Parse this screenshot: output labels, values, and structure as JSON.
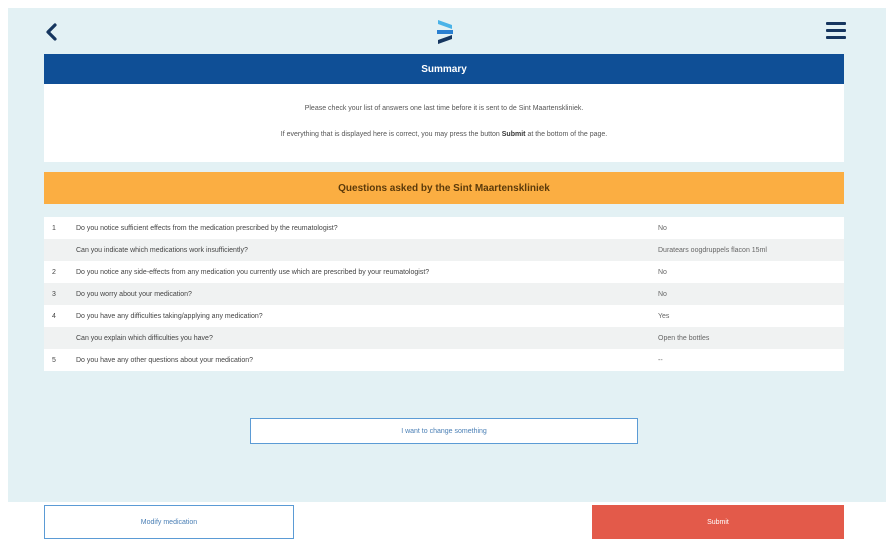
{
  "colors": {
    "page_bg": "#e3f1f4",
    "summary_header": "#0f4f96",
    "questions_header": "#fbae42",
    "submit": "#e35a4a",
    "outline": "#5b9bd5"
  },
  "topbar": {
    "back_icon": "chevron-left-icon",
    "logo_icon": "app-logo",
    "menu_icon": "hamburger-menu-icon"
  },
  "summary": {
    "title": "Summary",
    "line1": "Please check your list of answers one last time before it is sent to de Sint Maartenskliniek.",
    "line2_pre": "If everything that is displayed here is correct, you may press the button ",
    "line2_bold": "Submit",
    "line2_post": " at the bottom of the page."
  },
  "questions": {
    "title": "Questions asked by the Sint Maartenskliniek",
    "rows": [
      {
        "num": "1",
        "text": "Do you notice sufficient effects from the medication prescribed by the reumatologist?",
        "answer": "No"
      },
      {
        "num": "",
        "text": "Can you indicate which medications work insufficiently?",
        "answer": "Duratears oogdruppels flacon 15ml"
      },
      {
        "num": "2",
        "text": "Do you notice any side-effects from any medication you currently use which are prescribed by your reumatologist?",
        "answer": "No"
      },
      {
        "num": "3",
        "text": "Do you worry about your medication?",
        "answer": "No"
      },
      {
        "num": "4",
        "text": "Do you have any difficulties taking/applying any medication?",
        "answer": "Yes"
      },
      {
        "num": "",
        "text": "Can you explain which difficulties you have?",
        "answer": "Open the bottles"
      },
      {
        "num": "5",
        "text": "Do you have any other questions about your medication?",
        "answer": "--"
      }
    ]
  },
  "buttons": {
    "change": "I want to change something",
    "modify": "Modify medication",
    "submit": "Submit"
  }
}
